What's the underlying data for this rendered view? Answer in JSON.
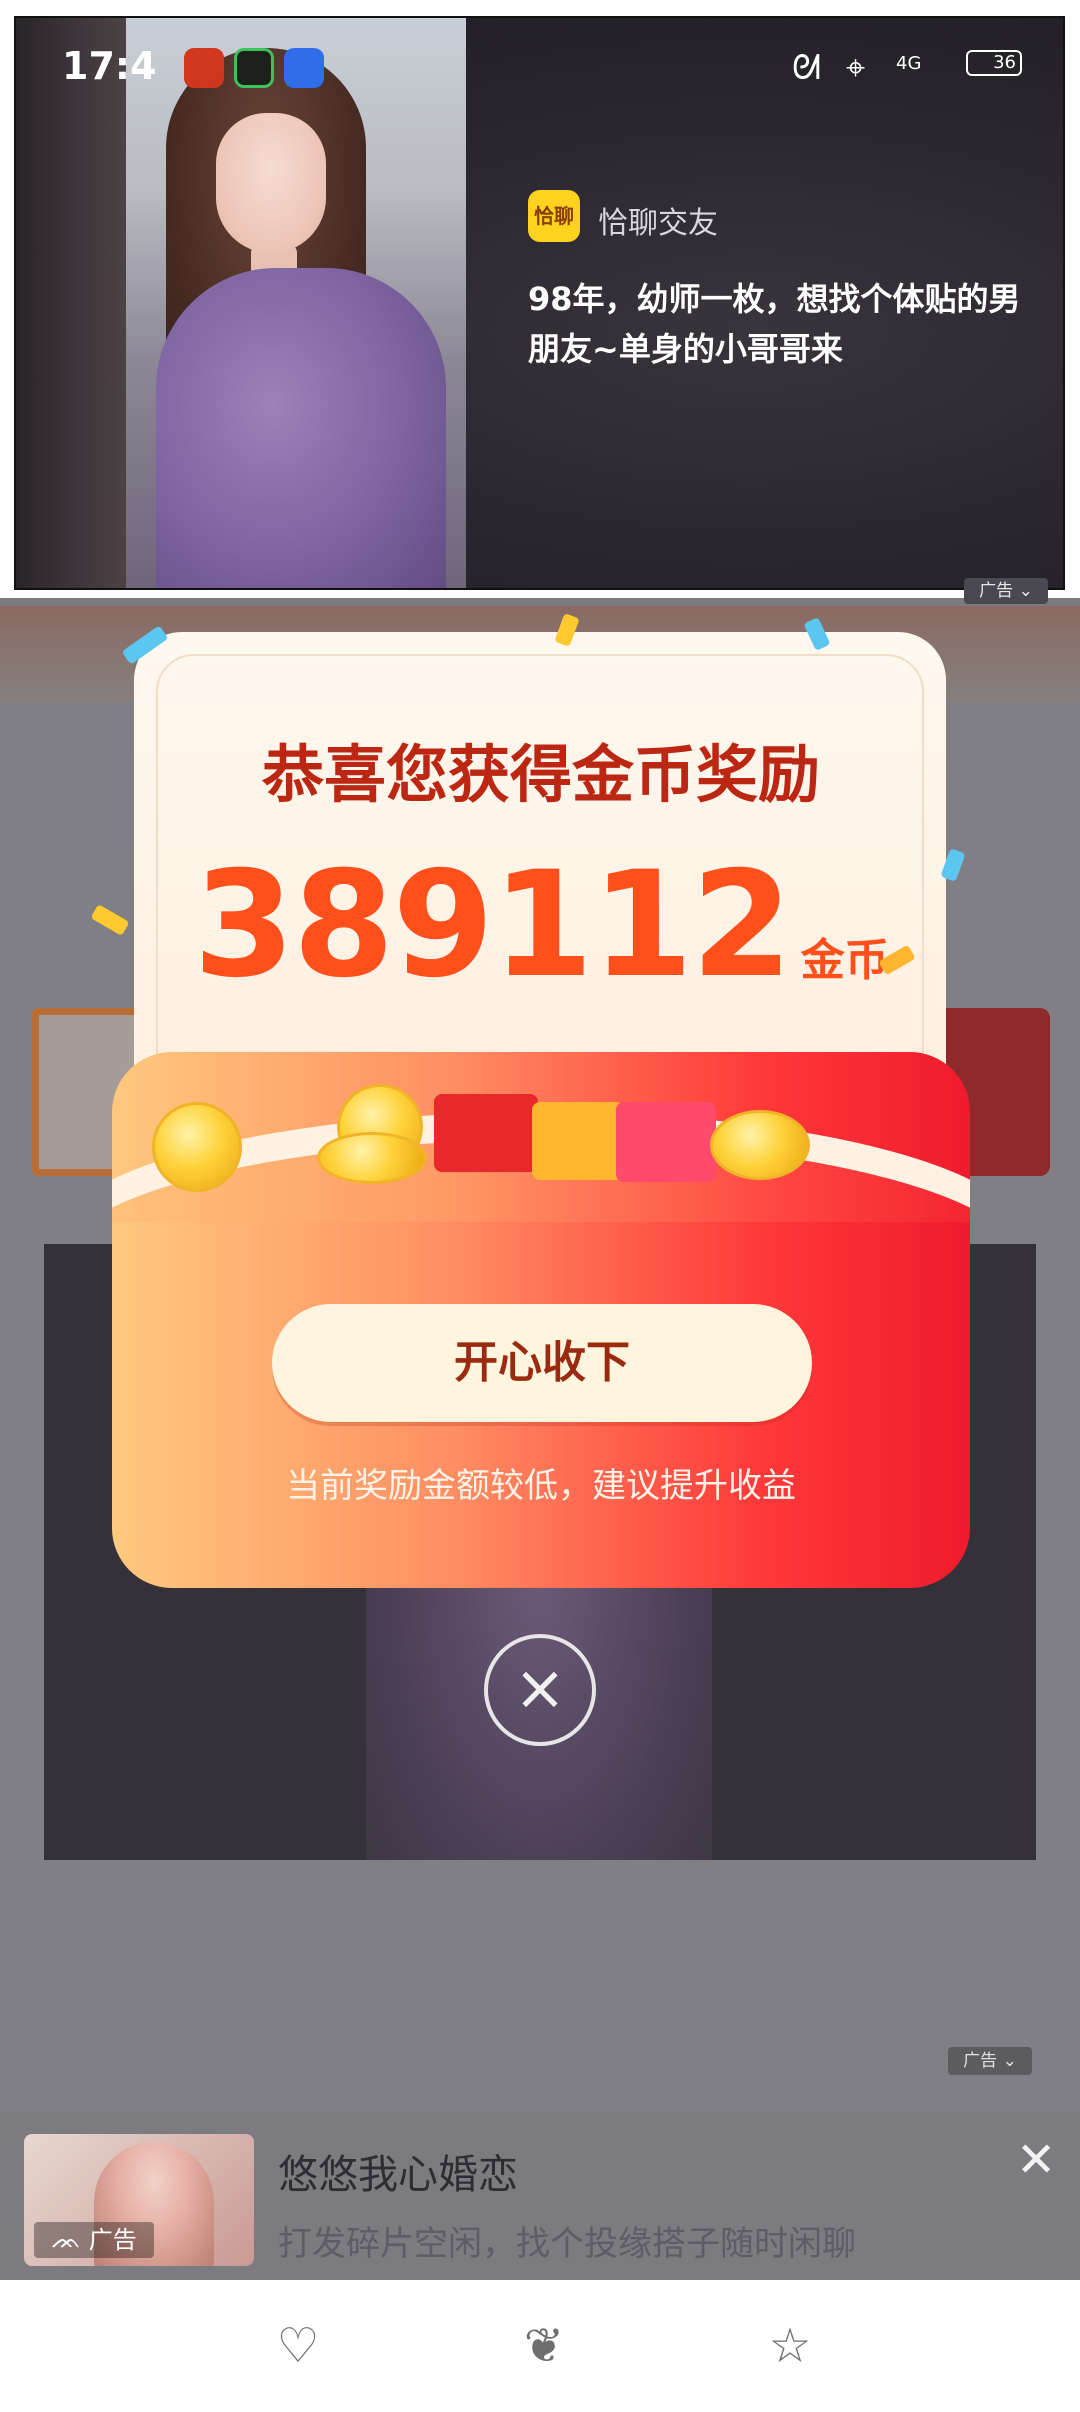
{
  "status_bar": {
    "time": "17:4",
    "icons": [
      "app-red-icon",
      "app-green-icon",
      "app-baidu-icon",
      "rabbit-icon",
      "location-icon",
      "signal-4g-icon",
      "battery-icon"
    ],
    "network": "4G",
    "battery": "36"
  },
  "top_ad": {
    "brand_logo_text": "恰聊",
    "brand_name": "恰聊交友",
    "description": "98年，幼师一枚，想找个体贴的男朋友~单身的小哥哥来",
    "badge": "广告"
  },
  "reward_popup": {
    "title": "恭喜您获得金币奖励",
    "amount": "389112",
    "unit": "金币",
    "accept_button": "开心收下",
    "hint": "当前奖励金额较低，建议提升收益",
    "colors": {
      "title": "#bb2712",
      "amount": "#ff4f1a",
      "envelope_left": "#ffc97e",
      "envelope_right": "#ef1b2d"
    }
  },
  "mid_ad": {
    "badge": "广告"
  },
  "bottom_ad": {
    "title": "悠悠我心婚恋",
    "subtitle": "打发碎片空闲，找个投缘搭子随时闲聊",
    "badge": "广告"
  },
  "navbar": {
    "icons": [
      "heart-icon",
      "leaf-icon",
      "star-list-icon"
    ]
  }
}
